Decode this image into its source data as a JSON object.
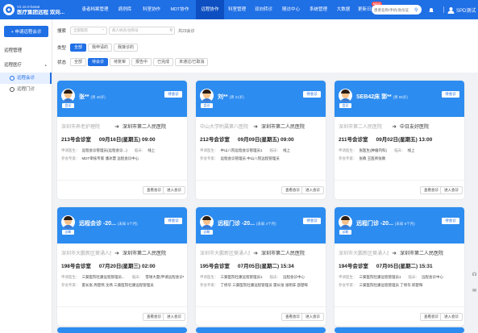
{
  "app": {
    "version": "V2.16.0-beta6",
    "name": "医疗集团远程 双向..."
  },
  "nav": {
    "items": [
      {
        "label": "患者档案管理"
      },
      {
        "label": "病例库"
      },
      {
        "label": "科室协作"
      },
      {
        "label": "MDT协作"
      },
      {
        "label": "远程协作"
      },
      {
        "label": "科室管理"
      },
      {
        "label": "双向转诊"
      },
      {
        "label": "随访中心"
      },
      {
        "label": "系统管理"
      },
      {
        "label": "大数据"
      },
      {
        "label": "更新日志",
        "badge": "NEW"
      }
    ],
    "active_index": 4
  },
  "header": {
    "search_placeholder": "患者名称/手机/身份证",
    "user": "SPD测试",
    "icons": [
      "search-icon",
      "bell-icon",
      "user-avatar-icon"
    ]
  },
  "sidebar": {
    "new_button": "+ 申请远程会诊",
    "items": [
      {
        "label": "远程管理"
      },
      {
        "label": "远程医疗",
        "expanded": true,
        "children": [
          {
            "label": "远程会诊",
            "active": true
          },
          {
            "label": "远程门诊",
            "active": false
          }
        ]
      }
    ]
  },
  "filters": {
    "search_label": "搜索",
    "select_placeholder": "全部医院",
    "search_placeholder": "病人姓名/住院号",
    "total": "共23会诊",
    "type_label": "类型",
    "type_options": [
      "全部",
      "我申请的",
      "我接诊的"
    ],
    "type_active": 0,
    "status_label": "状态",
    "status_options": [
      "全部",
      "待会诊",
      "待复审",
      "报告中",
      "已完成",
      "未通过/已取消"
    ],
    "status_active": 1
  },
  "cards": [
    {
      "title": "张**",
      "sub": "(男 46岁)",
      "status": "待会诊",
      "tag": "会诊",
      "from": "深圳市养老护理院",
      "to": "深圳市第二人民医院",
      "room": "213号会诊室",
      "time": "09月16日(星期五) 09:00",
      "info1_k": "申请医生：",
      "info1_v": "远程会诊管理员(远程会诊...)",
      "info1_k2": "临床：",
      "info1_v2": "线上",
      "info2_k": "参会专家：",
      "info2_v": "MDT审核专家 潘冰慧 远程会诊中心",
      "btn1": "查看会诊",
      "btn2": "进入会诊"
    },
    {
      "title": "刘**",
      "sub": "(男 21岁)",
      "status": "待会诊",
      "tag": "会诊",
      "from": "中山大学附属第八医院",
      "to": "深圳市第二人民医院",
      "room": "212号会诊室",
      "time": "09月09日(星期五) 09:00",
      "info1_k": "申请医生：",
      "info1_v": "中山八院远程会诊管理员1",
      "info1_k2": "临床：",
      "info1_v2": "线上",
      "info2_k": "参会专家：",
      "info2_v": "远程会诊管理员 中山八院远程管理员",
      "btn1": "查看会诊",
      "btn2": "进入会诊"
    },
    {
      "title": "SEB42床 郭**",
      "sub": "(男 85岁)",
      "status": "待会诊",
      "tag": "会诊",
      "from": "深圳市第二人民医院",
      "to": "中日友好医院",
      "room": "211号会诊室",
      "time": "09月02日(星期五) 13:00",
      "info1_k": "申请医生：",
      "info1_v": "张医生(肿瘤内科)",
      "info1_k2": "临床：",
      "info1_v2": "线上",
      "info2_k": "参会专家：",
      "info2_v": "张教 王医师张教",
      "btn1": "查看会诊",
      "btn2": "进入会诊"
    },
    {
      "title": "远程会诊 -20...",
      "sub": "(未知 5个月)",
      "status": "待会诊",
      "tag": "诊断",
      "from": "深圳市大鹏新区葵涌人民...",
      "to": "深圳市第二人民医院",
      "room": "198号会诊室",
      "time": "07月20日(星期三) 02:00",
      "info1_k": "申请医生：",
      "info1_v": "三葵医院社康远程管理员...",
      "info1_k2": "临床：",
      "info1_v2": "雪球大夏(申请远程会诊中心)",
      "info2_k": "参会专家：",
      "info2_v": "雷长张 周楚燕 沈燕 三葵医院社康远程管理员",
      "btn1": "查看会诊",
      "btn2": "进入会诊"
    },
    {
      "title": "远程门诊 -20...",
      "sub": "(未知 4个月)",
      "status": "待会诊",
      "tag": "诊断",
      "from": "深圳市大鹏新区葵涌人民...",
      "to": "深圳市第二人民医院",
      "room": "195号会诊室",
      "time": "07月05日(星期二) 15:34",
      "info1_k": "申请医生：",
      "info1_v": "三葵医院社康远程管理员1",
      "info1_k2": "临床：",
      "info1_v2": "远程会诊中心",
      "info2_k": "参会专家：",
      "info2_v": "丁修华 三葵医院社康远程管理员 雷长张 张明非 邵楚晖",
      "btn1": "查看会诊",
      "btn2": "进入会诊"
    },
    {
      "title": "远程门诊 -20...",
      "sub": "(未知 5个月)",
      "status": "待会诊",
      "tag": "诊断",
      "from": "深圳市大鹏新区葵涌人民...",
      "to": "深圳市第二人民医院",
      "room": "194号会诊室",
      "time": "07月05日(星期二) 15:31",
      "info1_k": "申请医生：",
      "info1_v": "三葵医院社康远程管理员1",
      "info1_k2": "临床：",
      "info1_v2": "远程会诊中心",
      "info2_k": "参会专家：",
      "info2_v": "三葵医院社康远程管理员 丁修华 邱楚晖",
      "btn1": "查看会诊",
      "btn2": "进入会诊"
    }
  ],
  "colors": {
    "primary": "#1f6fe5",
    "card_header": "#2d8cf0",
    "nav_active": "#0d4fc1"
  }
}
